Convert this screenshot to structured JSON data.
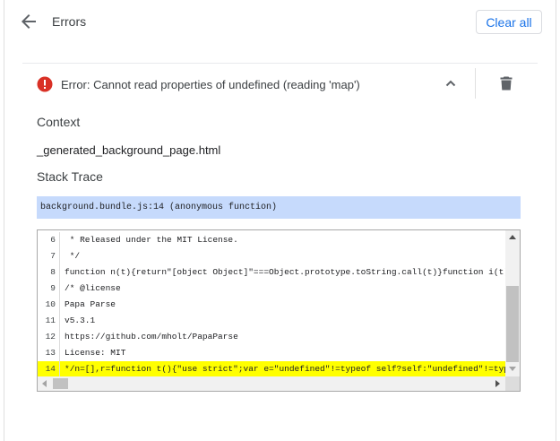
{
  "header": {
    "title": "Errors",
    "clear_all_label": "Clear all"
  },
  "error": {
    "message": "Error: Cannot read properties of undefined (reading 'map')"
  },
  "context": {
    "heading": "Context",
    "value": "_generated_background_page.html"
  },
  "stack_trace": {
    "heading": "Stack Trace",
    "frame": "background.bundle.js:14 (anonymous function)"
  },
  "code": {
    "lines": [
      {
        "num": "6",
        "text": " * Released under the MIT License."
      },
      {
        "num": "7",
        "text": " */"
      },
      {
        "num": "8",
        "text": "function n(t){return\"[object Object]\"===Object.prototype.toString.call(t)}function i(t){var e,"
      },
      {
        "num": "9",
        "text": "/* @license"
      },
      {
        "num": "10",
        "text": "Papa Parse"
      },
      {
        "num": "11",
        "text": "v5.3.1"
      },
      {
        "num": "12",
        "text": "https://github.com/mholt/PapaParse"
      },
      {
        "num": "13",
        "text": "License: MIT"
      },
      {
        "num": "14",
        "text": "*/n=[],r=function t(){\"use strict\";var e=\"undefined\"!=typeof self?self:\"undefined\"!=typeof win"
      }
    ],
    "highlight_line": "14"
  },
  "colors": {
    "accent": "#1a73e8",
    "error_red": "#d93025",
    "frame_highlight": "#c6dafc",
    "line_highlight": "#ffff00"
  },
  "icons": {
    "back": "arrow-back-icon",
    "error": "error-circle-icon",
    "collapse": "chevron-up-icon",
    "delete": "trash-icon"
  }
}
